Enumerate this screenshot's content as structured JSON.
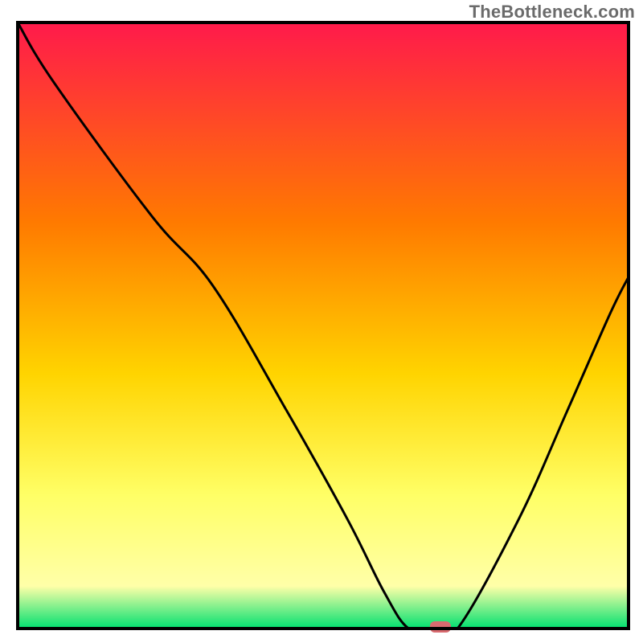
{
  "watermark": "TheBottleneck.com",
  "chart_data": {
    "type": "line",
    "title": "",
    "xlabel": "",
    "ylabel": "",
    "xlim": [
      0,
      100
    ],
    "ylim": [
      0,
      100
    ],
    "grid": false,
    "series": [
      {
        "name": "bottleneck-curve",
        "x": [
          0,
          6,
          22,
          32,
          44,
          54,
          60,
          64,
          68,
          72,
          82,
          90,
          97,
          100
        ],
        "values": [
          100,
          90,
          68,
          56.5,
          36,
          18,
          6,
          0,
          0,
          0,
          18,
          36,
          52,
          58
        ]
      }
    ],
    "marker": {
      "x": 69.2,
      "y": 0
    },
    "background_gradient": {
      "top": "#ff1a4b",
      "mid1": "#ff7a00",
      "mid2": "#ffd400",
      "pale": "#ffff66",
      "palest": "#ffffa8",
      "green": "#00e070"
    },
    "frame_color": "#000000",
    "curve_color": "#000000",
    "marker_color": "#d86a6f"
  }
}
